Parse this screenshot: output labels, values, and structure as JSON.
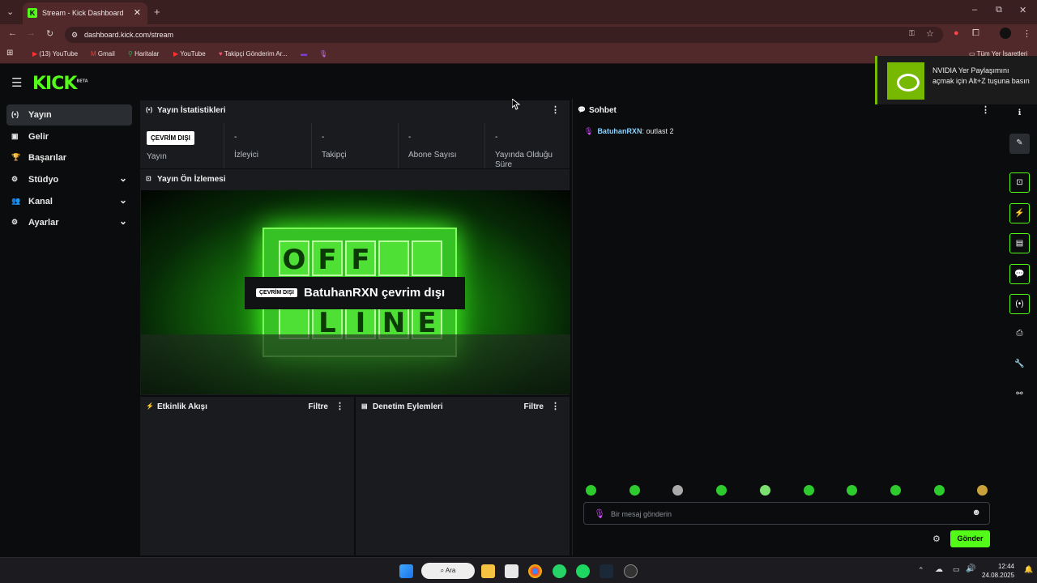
{
  "browser": {
    "tab_title": "Stream - Kick Dashboard",
    "tab_icon_letter": "K",
    "url": "dashboard.kick.com/stream",
    "bookmarks": [
      {
        "label": "(13) YouTube"
      },
      {
        "label": "Gmail"
      },
      {
        "label": "Haritalar"
      },
      {
        "label": "YouTube"
      },
      {
        "label": "Takipçi Gönderim Ar..."
      }
    ],
    "all_bookmarks": "Tüm Yer İşaretleri"
  },
  "app": {
    "logo": "KICK",
    "logo_badge": "BETA",
    "sidebar": [
      {
        "label": "Yayın",
        "active": true
      },
      {
        "label": "Gelir"
      },
      {
        "label": "Başarılar"
      },
      {
        "label": "Stüdyo",
        "expandable": true
      },
      {
        "label": "Kanal",
        "expandable": true
      },
      {
        "label": "Ayarlar",
        "expandable": true
      }
    ],
    "stats": {
      "title": "Yayın İstatistikleri",
      "status_badge": "ÇEVRİM DIŞI",
      "items": [
        {
          "value": "",
          "label": "Yayın"
        },
        {
          "value": "-",
          "label": "İzleyici"
        },
        {
          "value": "-",
          "label": "Takipçi"
        },
        {
          "value": "-",
          "label": "Abone Sayısı"
        },
        {
          "value": "-",
          "label": "Yayında Olduğu Süre"
        }
      ]
    },
    "preview": {
      "title": "Yayın Ön İzlemesi",
      "offline_badge": "ÇEVRİM DIŞI",
      "offline_text": "BatuhanRXN çevrim dışı",
      "sign_top": [
        "O",
        "F",
        "F",
        "",
        ""
      ],
      "sign_bottom": [
        "",
        "L",
        "I",
        "N",
        "E"
      ]
    },
    "activity": {
      "title": "Etkinlik Akışı",
      "filter": "Filtre"
    },
    "moderation": {
      "title": "Denetim Eylemleri",
      "filter": "Filtre"
    },
    "chat": {
      "title": "Sohbet",
      "messages": [
        {
          "user": "BatuhanRXN",
          "text": "outlast 2"
        }
      ],
      "placeholder": "Bir mesaj gönderin",
      "send": "Gönder"
    }
  },
  "overlay": {
    "nvidia_text": "NVIDIA Yer Paylaşımını açmak için Alt+Z tuşuna basın"
  },
  "taskbar": {
    "search": "Ara",
    "time": "12:44",
    "date": "24.08.2025"
  },
  "colors": {
    "accent": "#53fc18",
    "panel": "#191b1f",
    "background": "#0b0c0d",
    "browser_frame": "#51292a"
  }
}
